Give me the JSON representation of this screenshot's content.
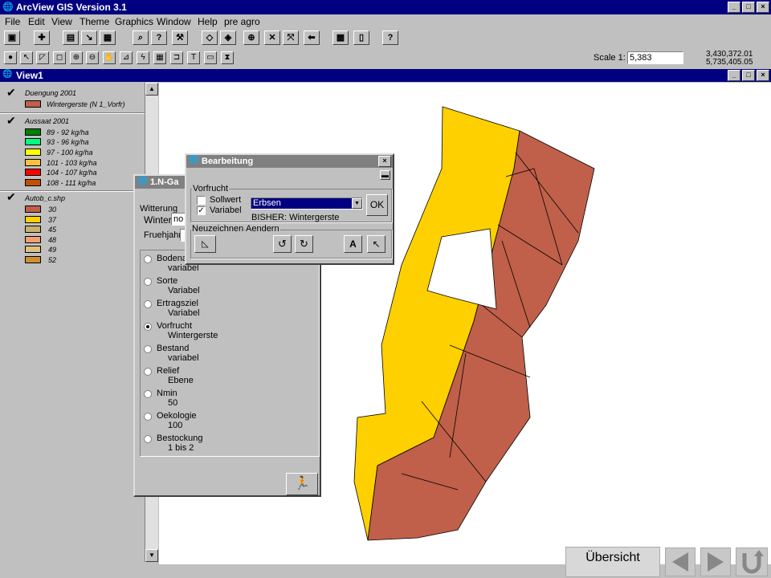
{
  "app": {
    "title": "ArcView GIS Version 3.1"
  },
  "menu": [
    "File",
    "Edit",
    "View",
    "Theme",
    "Graphics",
    "Window",
    "Help",
    "pre agro"
  ],
  "scale": {
    "label": "Scale 1:",
    "value": "5,383",
    "coord_x": "3,430,372.01",
    "coord_y": "5,735,405.05"
  },
  "view": {
    "title": "View1"
  },
  "legend": {
    "themes": [
      {
        "name": "Duengung 2001",
        "checked": true,
        "items": [
          {
            "label": "Wintergerste (N 1_Vorfr)",
            "color": "#c0604a"
          }
        ]
      },
      {
        "name": "Aussaat 2001",
        "checked": true,
        "items": [
          {
            "label": "89 - 92 kg/ha",
            "color": "#008000"
          },
          {
            "label": "93 - 96 kg/ha",
            "color": "#00ff80"
          },
          {
            "label": "97 - 100 kg/ha",
            "color": "#ffff00"
          },
          {
            "label": "101 - 103 kg/ha",
            "color": "#ffc040"
          },
          {
            "label": "104 - 107 kg/ha",
            "color": "#ff0000"
          },
          {
            "label": "108 - 111 kg/ha",
            "color": "#c05000"
          }
        ]
      },
      {
        "name": "Autob_c.shp",
        "checked": true,
        "items": [
          {
            "label": "30",
            "color": "#c0604a"
          },
          {
            "label": "37",
            "color": "#ffd000"
          },
          {
            "label": "45",
            "color": "#c8b070"
          },
          {
            "label": "48",
            "color": "#f0a070"
          },
          {
            "label": "49",
            "color": "#e0c080"
          },
          {
            "label": "52",
            "color": "#d09030"
          }
        ]
      }
    ]
  },
  "ngabe": {
    "title": "1.N-Ga",
    "witterung_label": "Witterung",
    "winter_label": "Winter",
    "winter_value": "no",
    "fruehjahr_label": "Fruehjahr",
    "options": [
      {
        "name": "Bodena",
        "value": "variabel",
        "selected": false
      },
      {
        "name": "Sorte",
        "value": "Variabel",
        "selected": false
      },
      {
        "name": "Ertragsziel",
        "value": "Variabel",
        "selected": false
      },
      {
        "name": "Vorfrucht",
        "value": "Wintergerste",
        "selected": true
      },
      {
        "name": "Bestand",
        "value": "variabel",
        "selected": false
      },
      {
        "name": "Relief",
        "value": "Ebene",
        "selected": false
      },
      {
        "name": "Nmin",
        "value": "50",
        "selected": false
      },
      {
        "name": "Oekologie",
        "value": "100",
        "selected": false
      },
      {
        "name": "Bestockung",
        "value": "1 bis 2",
        "selected": false
      }
    ]
  },
  "bearbeitung": {
    "title": "Bearbeitung",
    "group_label": "Vorfrucht",
    "sollwert_label": "Sollwert",
    "variabel_label": "Variabel",
    "dropdown_value": "Erbsen",
    "ok_label": "OK",
    "bisher_text": "BISHER: Wintergerste",
    "neuzeichnen_label": "Neuzeichnen",
    "aendern_label": "Aendern",
    "a_label": "A"
  },
  "nav": {
    "uebersicht": "Übersicht"
  },
  "colors": {
    "titlebar": "#000080",
    "field_yellow": "#ffd000",
    "field_brown": "#c0604a"
  }
}
